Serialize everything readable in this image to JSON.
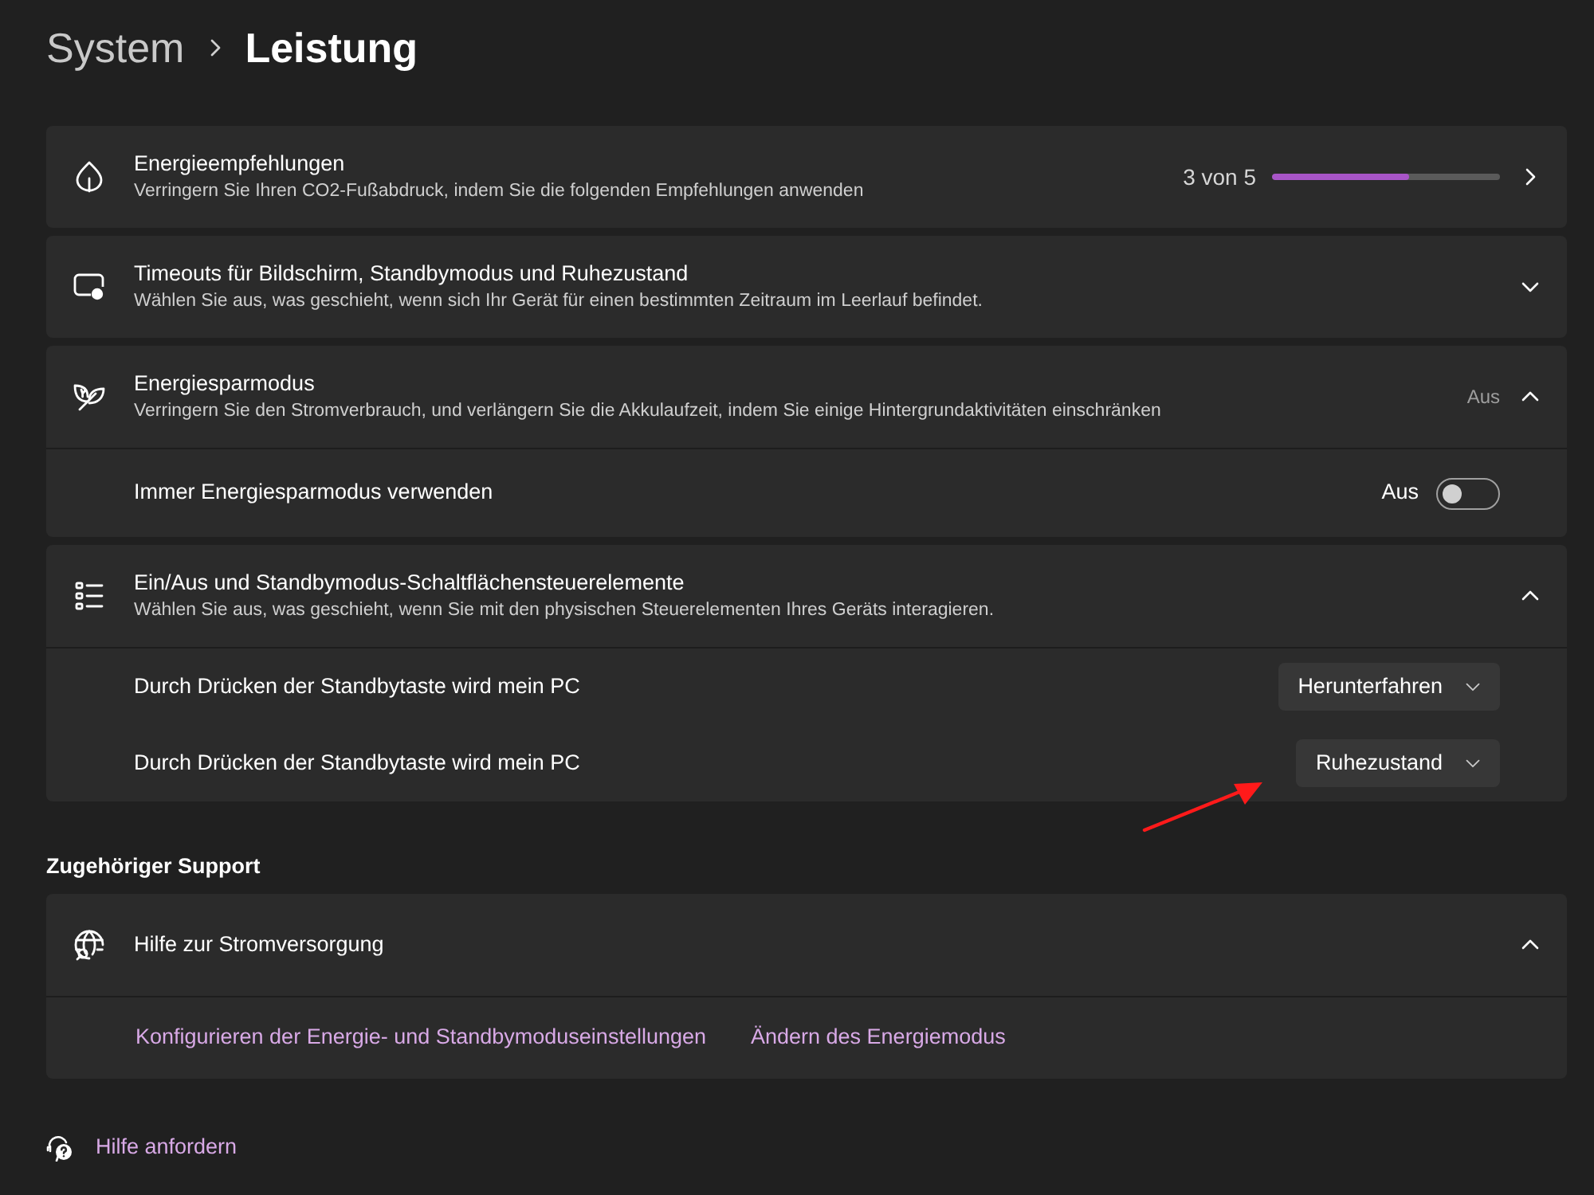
{
  "breadcrumb": [
    {
      "label": "System",
      "current": false
    },
    {
      "label": "Leistung",
      "current": true
    }
  ],
  "settings": [
    {
      "kind": "link",
      "title": "Energieempfehlungen",
      "description": "Verringern Sie Ihren CO2-Fußabdruck, indem Sie die folgenden Empfehlungen anwenden",
      "progress": {
        "text": "3 von 5",
        "level": 0.6
      }
    },
    {
      "kind": "expander",
      "title": "Timeouts für Bildschirm, Standbymodus und Ruhezustand",
      "description": "Wählen Sie aus, was geschieht, wenn sich Ihr Gerät für einen bestimmten Zeitraum im Leerlauf befindet.",
      "expanded": false
    },
    {
      "kind": "expander",
      "title": "Energiesparmodus",
      "description": "Verringern Sie den Stromverbrauch, und verlängern Sie die Akkulaufzeit, indem Sie einige Hintergrundaktivitäten einschränken",
      "status": "Aus",
      "expanded": true,
      "rows": [
        {
          "kind": "toggle",
          "label": "Immer Energiesparmodus verwenden",
          "state_text": "Aus",
          "on": false
        }
      ]
    },
    {
      "kind": "expander",
      "title": "Ein/Aus und Standbymodus-Schaltflächensteuerelemente",
      "description": "Wählen Sie aus, was geschieht, wenn Sie mit den physischen Steuerelementen Ihres Geräts interagieren.",
      "expanded": true,
      "rows": [
        {
          "kind": "dropdown",
          "label": "Durch Drücken der Standbytaste wird mein PC",
          "value": "Herunterfahren"
        },
        {
          "kind": "dropdown",
          "label": "Durch Drücken der Standbytaste wird mein PC",
          "value": "Ruhezustand"
        }
      ]
    }
  ],
  "related_support": {
    "heading": "Zugehöriger Support",
    "items": [
      {
        "kind": "expander",
        "title": "Hilfe zur Stromversorgung",
        "expanded": true,
        "rows": [
          {
            "kind": "links",
            "links": [
              "Konfigurieren der Energie- und Standbymoduseinstellungen",
              "Ändern des Energiemodus"
            ]
          }
        ]
      }
    ]
  },
  "footer_link": "Hilfe anfordern"
}
